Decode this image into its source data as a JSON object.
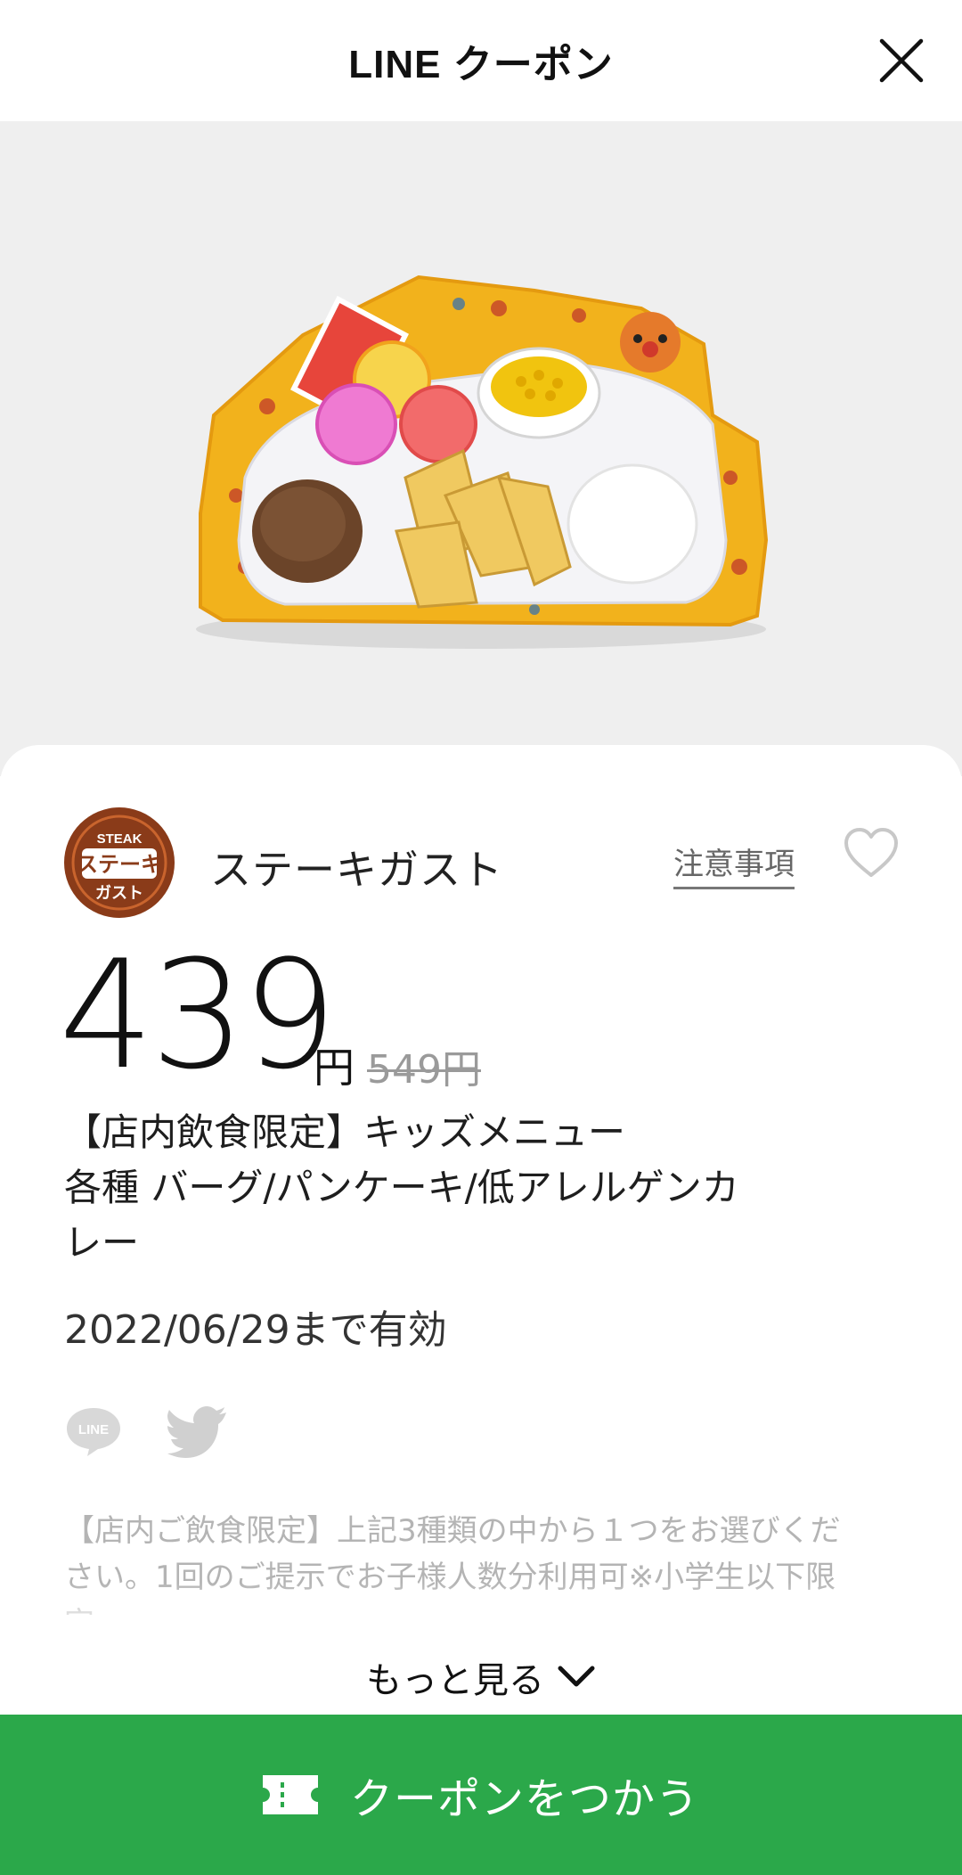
{
  "header": {
    "title": "LINE クーポン"
  },
  "hero": {
    "image_alt": "kids-plate-photo"
  },
  "store": {
    "logo_top": "STEAK",
    "logo_mid": "ステーキ",
    "logo_bottom": "ガスト",
    "name": "ステーキガスト",
    "notice_label": "注意事項"
  },
  "price": {
    "current": "439",
    "yen": "円",
    "original": "549円"
  },
  "coupon": {
    "title_line1": "【店内飲食限定】キッズメニュー",
    "title_line2": "各種 バーグ/パンケーキ/低アレルゲンカ",
    "title_line3": "レー",
    "expiry": "2022/06/29まで有効",
    "description_line1": "【店内ご飲食限定】上記3種類の中から１つをお選びくだ",
    "description_line2": "さい。1回のご提示でお子様人数分利用可※小学生以下限",
    "description_line3": "定"
  },
  "share": {
    "line_label": "LINE"
  },
  "actions": {
    "more_label": "もっと見る",
    "use_label": "クーポンをつかう"
  },
  "colors": {
    "accent": "#2ba84a",
    "logo_brown": "#8a3b19"
  }
}
